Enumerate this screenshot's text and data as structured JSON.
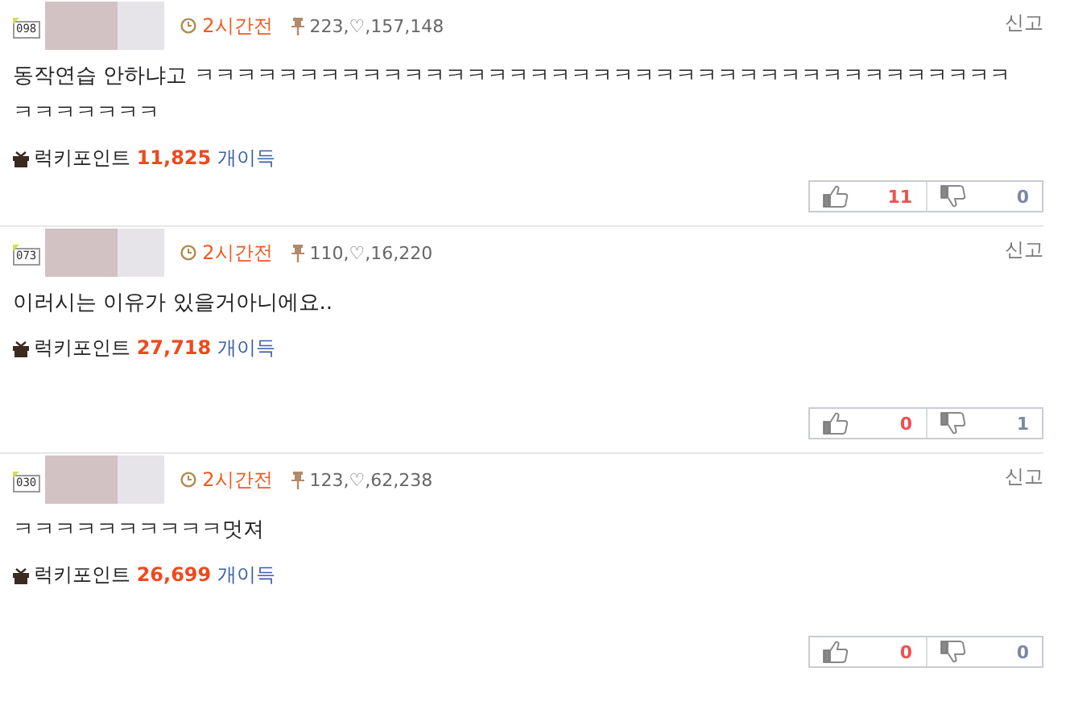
{
  "comments": [
    {
      "level": "098",
      "time": "2시간전",
      "stats": "223,♡,157,148",
      "report": "신고",
      "text": "동작연습 안하냐고 ㅋㅋㅋㅋㅋㅋㅋㅋㅋㅋㅋㅋㅋㅋㅋㅋㅋㅋㅋㅋㅋㅋㅋㅋㅋㅋㅋㅋㅋㅋㅋㅋㅋㅋㅋㅋㅋㅋㅋㅋㅋㅋㅋㅋㅋㅋ",
      "points_label": "럭키포인트",
      "points": "11,825",
      "points_suffix": "개이득",
      "up": "11",
      "down": "0"
    },
    {
      "level": "073",
      "time": "2시간전",
      "stats": "110,♡,16,220",
      "report": "신고",
      "text": "이러시는 이유가 있을거아니에요..",
      "points_label": "럭키포인트",
      "points": "27,718",
      "points_suffix": "개이득",
      "up": "0",
      "down": "1"
    },
    {
      "level": "030",
      "time": "2시간전",
      "stats": "123,♡,62,238",
      "report": "신고",
      "text": "ㅋㅋㅋㅋㅋㅋㅋㅋㅋㅋ멋져",
      "points_label": "럭키포인트",
      "points": "26,699",
      "points_suffix": "개이득",
      "up": "0",
      "down": "0"
    }
  ]
}
